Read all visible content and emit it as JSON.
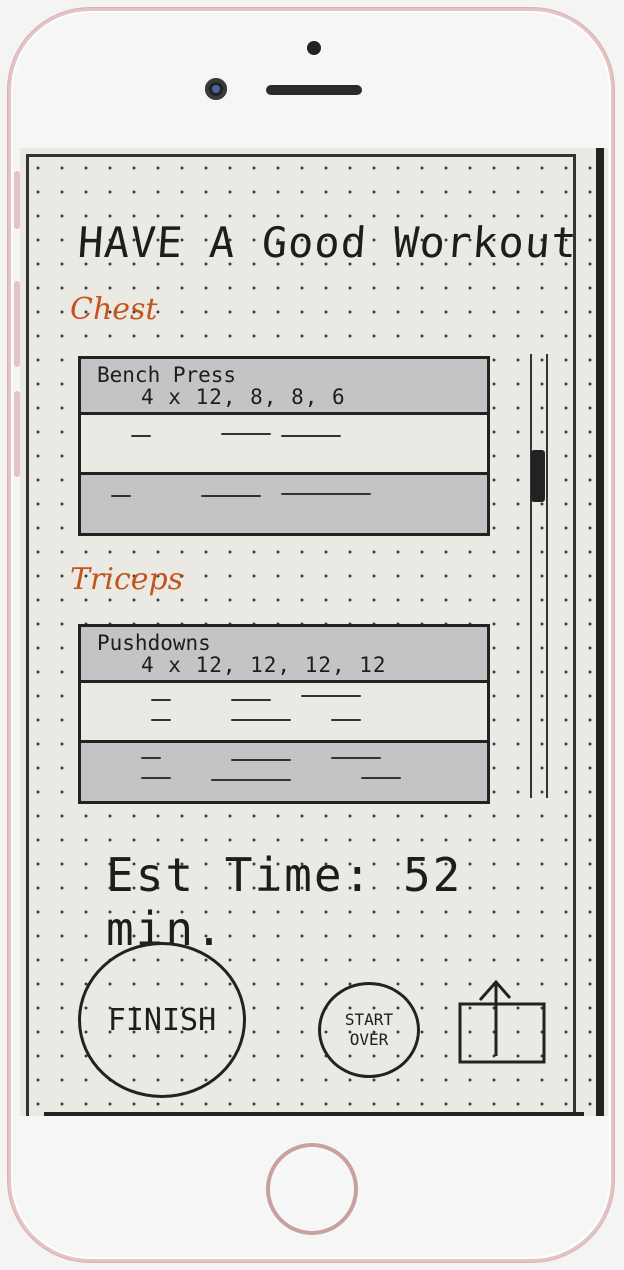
{
  "title": "HAVE A Good Workout",
  "sections": [
    {
      "name": "Chest",
      "exercise": {
        "name": "Bench Press",
        "sets": "4 x 12, 8, 8, 6"
      }
    },
    {
      "name": "Triceps",
      "exercise": {
        "name": "Pushdowns",
        "sets": "4 x 12, 12, 12, 12"
      }
    }
  ],
  "estimate": "Est Time: 52 min.",
  "buttons": {
    "finish": "FINISH",
    "start_over": "START OVER"
  },
  "icons": {
    "share": "share-icon"
  }
}
